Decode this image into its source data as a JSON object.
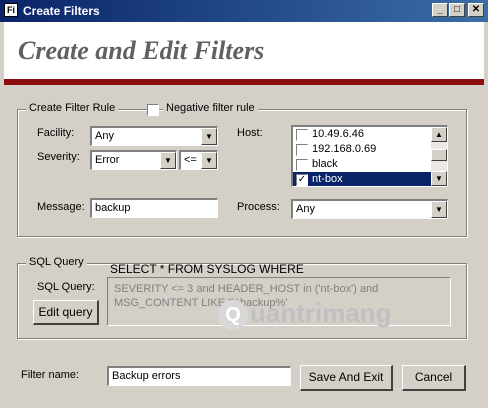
{
  "window": {
    "title": "Create Filters",
    "icon": "app-icon",
    "icon_label": "Fi",
    "controls": {
      "minimize": "_",
      "maximize": "□",
      "close": "✕"
    }
  },
  "header": {
    "title": "Create and Edit Filters",
    "accent_color": "#8b0d0d"
  },
  "filter_rule": {
    "legend": "Create Filter Rule",
    "negative_label": "Negative filter rule",
    "negative_checked": false,
    "facility_label": "Facility:",
    "facility_value": "Any",
    "severity_label": "Severity:",
    "severity_value": "Error",
    "operator_value": "<=",
    "host_label": "Host:",
    "hosts": [
      {
        "label": "10.49.6.46",
        "checked": false,
        "selected": false
      },
      {
        "label": "192.168.0.69",
        "checked": false,
        "selected": false
      },
      {
        "label": "black",
        "checked": false,
        "selected": false
      },
      {
        "label": "nt-box",
        "checked": true,
        "selected": true
      }
    ],
    "message_label": "Message:",
    "message_value": "backup",
    "process_label": "Process:",
    "process_value": "Any"
  },
  "sql": {
    "legend": "SQL Query",
    "label": "SQL Query:",
    "header": "SELECT * FROM SYSLOG WHERE",
    "text": "SEVERITY <= 3 and HEADER_HOST in ('nt-box') and MSG_CONTENT LIKE '%backup%'",
    "edit_button": "Edit query"
  },
  "footer": {
    "filter_name_label": "Filter name:",
    "filter_name_value": "Backup errors",
    "save_button": "Save And Exit",
    "cancel_button": "Cancel"
  },
  "watermark": {
    "text": "uantrimang",
    "logo_letter": "Q"
  },
  "icons": {
    "dropdown": "▼",
    "scroll_up": "▲",
    "scroll_down": "▼",
    "check": "✓"
  }
}
